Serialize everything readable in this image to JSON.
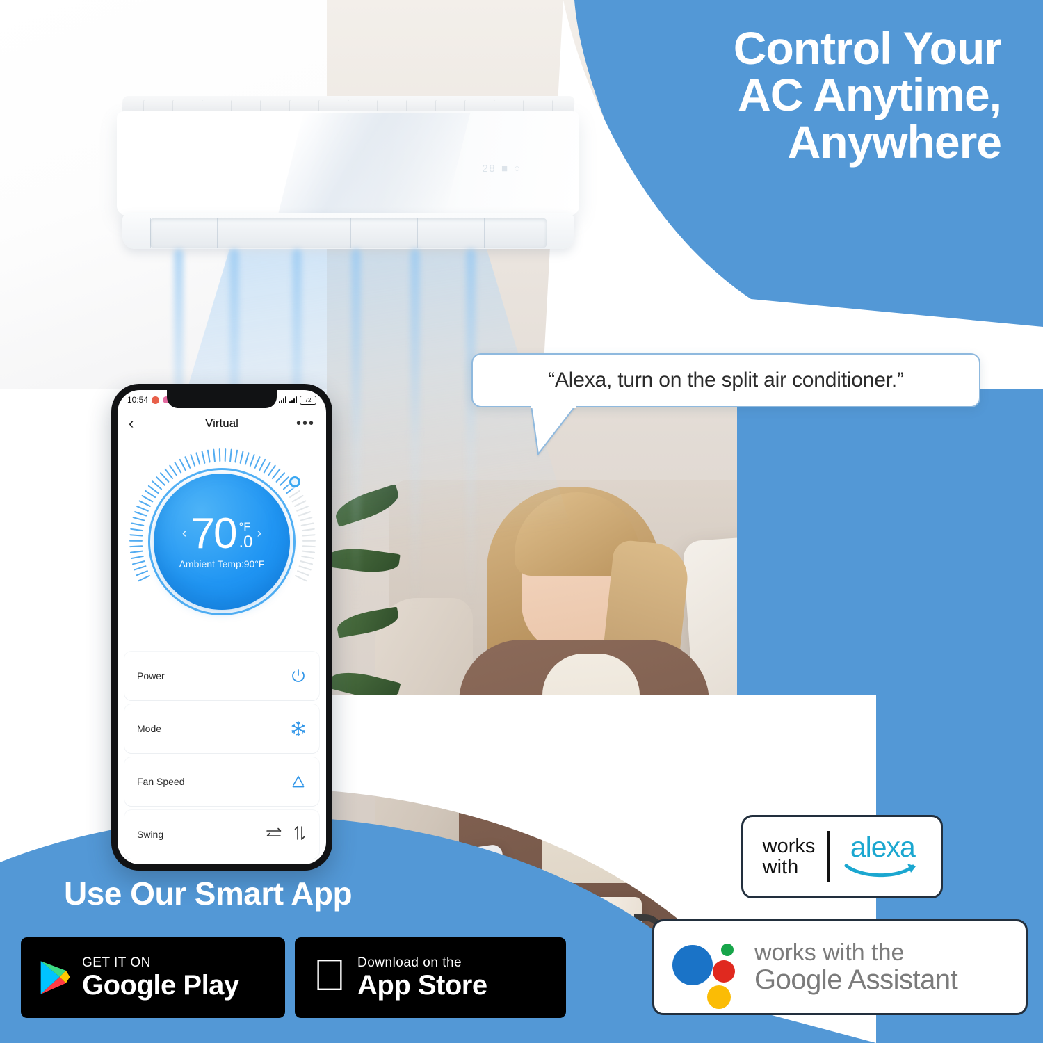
{
  "brand": {
    "blue": "#5398d6",
    "accent": "#2196f3"
  },
  "headline": {
    "line1": "Control Your",
    "line2": "AC Anytime,",
    "line3": "Anywhere"
  },
  "speech_bubble": {
    "text": "“Alexa, turn on the split air conditioner.”"
  },
  "phone": {
    "status_bar": {
      "time": "10:54",
      "battery": "72"
    },
    "app_bar": {
      "back_icon": "‹",
      "title": "Virtual",
      "menu_icon": "•••"
    },
    "thermostat": {
      "value": "70",
      "decimal": ".0",
      "unit": "°F",
      "left_arrow": "‹",
      "right_arrow": "›",
      "ambient_label": "Ambient Temp:90°F"
    },
    "controls": [
      {
        "label": "Power",
        "icons": [
          "power-icon"
        ]
      },
      {
        "label": "Mode",
        "icons": [
          "snowflake-icon"
        ]
      },
      {
        "label": "Fan Speed",
        "icons": [
          "auto-fan-icon"
        ]
      },
      {
        "label": "Swing",
        "icons": [
          "swing-horizontal-icon",
          "swing-vertical-icon"
        ]
      }
    ]
  },
  "smart_app": {
    "title": "Use Our Smart App",
    "google_play": {
      "top": "GET IT ON",
      "bottom": "Google Play"
    },
    "app_store": {
      "top": "Download on the",
      "bottom": "App Store"
    }
  },
  "alexa_badge": {
    "line1": "works",
    "line2": "with",
    "brand": "alexa"
  },
  "google_badge": {
    "line1": "works with the",
    "line2": "Google Assistant"
  },
  "ac_unit": {
    "display": "28"
  }
}
